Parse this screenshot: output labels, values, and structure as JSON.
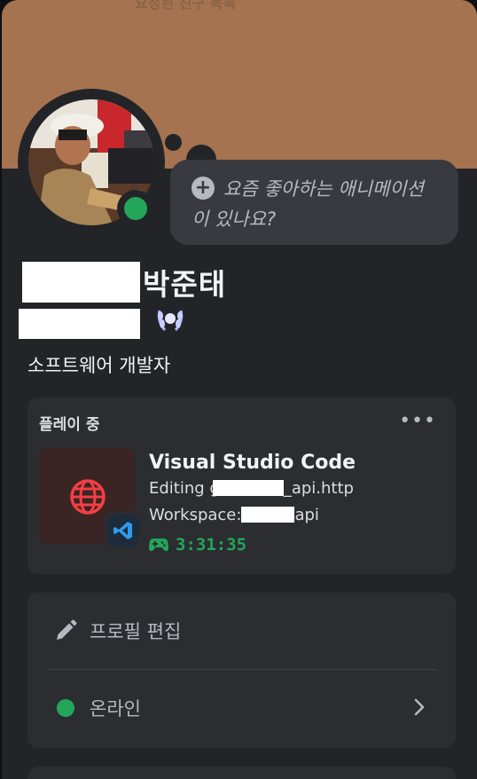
{
  "banner": {
    "color": "#a57350",
    "top_text": "요청된 친구 목록"
  },
  "avatar": {
    "status": "online",
    "status_color": "#23a55a"
  },
  "status_bubble": {
    "placeholder": "요즘 좋아하는 애니메이션이 있나요?"
  },
  "profile": {
    "display_name_visible": "박준태",
    "bio": "소프트웨어 개발자",
    "badge": "nitro-laurel-badge"
  },
  "activity": {
    "header": "플레이 중",
    "app_name": "Visual Studio Code",
    "details_prefix": "Editing g",
    "details_suffix": "_api.http",
    "state_prefix": "Workspace:",
    "state_suffix": "api",
    "elapsed": "3:31:35",
    "accent": "#23a55a"
  },
  "menu": {
    "edit_profile": "프로필 편집",
    "status_label": "온라인"
  }
}
